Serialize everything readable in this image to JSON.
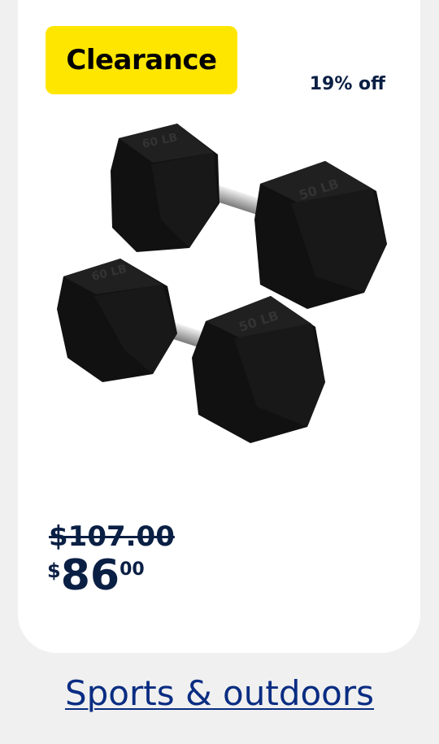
{
  "badge": {
    "label": "Clearance",
    "color": "#ffe600"
  },
  "discount": "19% off",
  "product": {
    "image_icon": "hex-dumbbells-image"
  },
  "price": {
    "was": "$107.00",
    "currency": "$",
    "dollars": "86",
    "cents": "00"
  },
  "category": {
    "label": "Sports & outdoors"
  },
  "colors": {
    "text": "#0a1f44",
    "link": "#0a2d82"
  }
}
